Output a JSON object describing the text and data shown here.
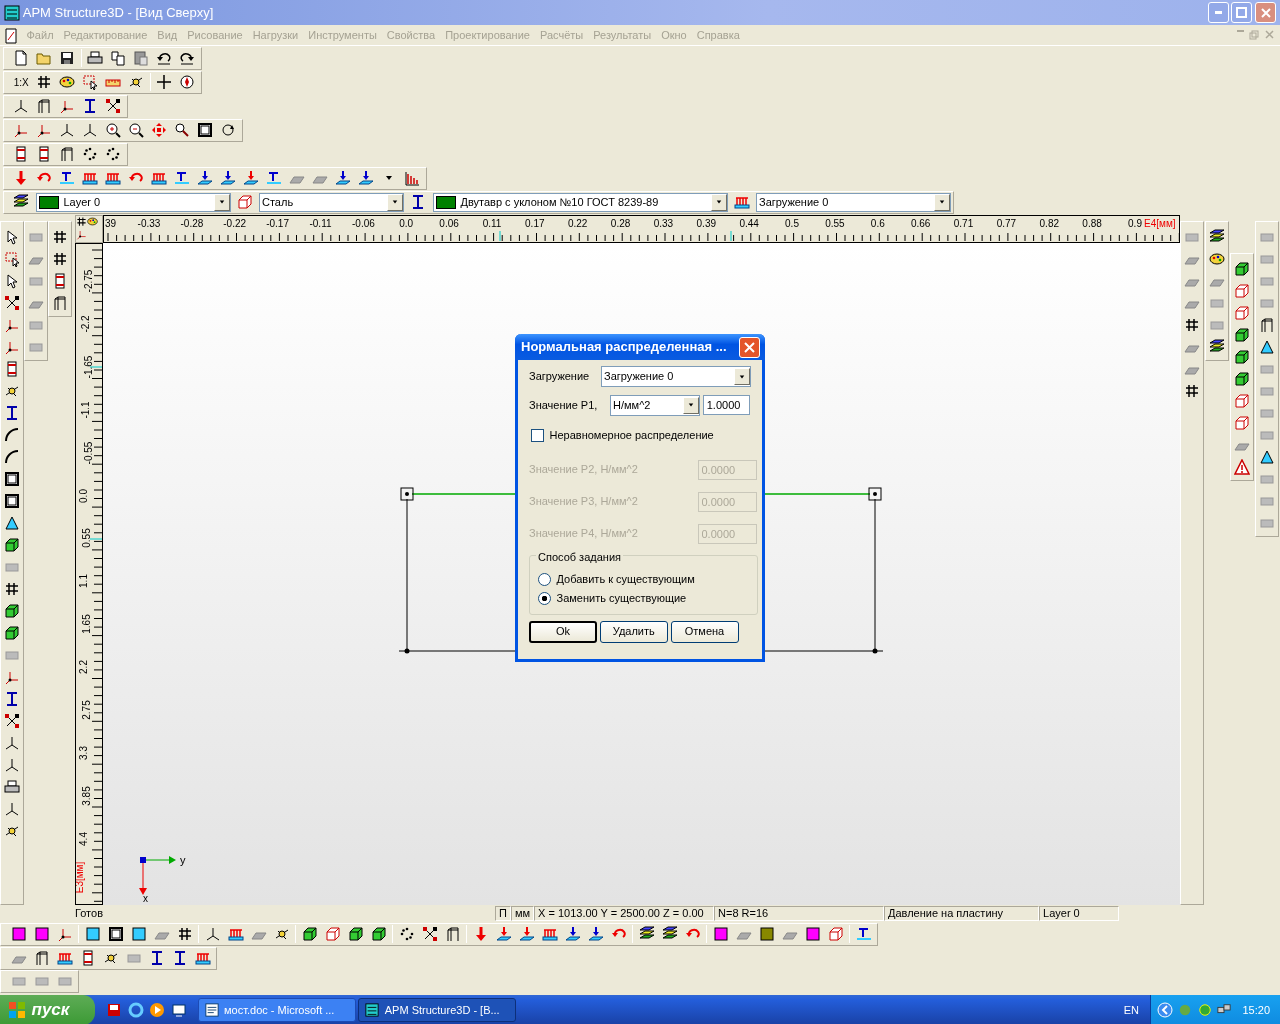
{
  "window": {
    "title": "APM Structure3D - [Вид Сверху]"
  },
  "menu": [
    {
      "label": "Файл",
      "disabled": true
    },
    {
      "label": "Редактирование",
      "disabled": true
    },
    {
      "label": "Вид",
      "disabled": true
    },
    {
      "label": "Рисование",
      "disabled": true
    },
    {
      "label": "Нагрузки",
      "disabled": true
    },
    {
      "label": "Инструменты",
      "disabled": true
    },
    {
      "label": "Свойства",
      "disabled": true
    },
    {
      "label": "Проектирование",
      "disabled": true
    },
    {
      "label": "Расчёты",
      "disabled": true
    },
    {
      "label": "Результаты",
      "disabled": true
    },
    {
      "label": "Окно",
      "disabled": true
    },
    {
      "label": "Справка",
      "disabled": true
    }
  ],
  "scale_button": "1:X",
  "combos": [
    {
      "kind": "layer",
      "value": "Layer 0",
      "color": "#008000"
    },
    {
      "kind": "material",
      "value": "Сталь"
    },
    {
      "kind": "section",
      "value": "Двутавр с уклоном  №10 ГОСТ 8239-89",
      "color": "#008000"
    },
    {
      "kind": "load",
      "value": "Загружение 0"
    }
  ],
  "ruler_x": {
    "labels": [
      "39",
      "-0.33",
      "-0.28",
      "-0.22",
      "-0.17",
      "-0.11",
      "-0.06",
      "0.0",
      "0.06",
      "0.11",
      "0.17",
      "0.22",
      "0.28",
      "0.33",
      "0.39",
      "0.44",
      "0.5",
      "0.55",
      "0.6",
      "0.66",
      "0.71",
      "0.77",
      "0.82",
      "0.88",
      "0.9"
    ],
    "unit": "E4[мм]"
  },
  "ruler_y": {
    "labels": [
      "-2.75",
      "-2.2",
      "-1.65",
      "-1.1",
      "-0.55",
      "0.0",
      "0.55",
      "1.1",
      "1.65",
      "2.2",
      "2.75",
      "3.3",
      "3.85",
      "4.4"
    ],
    "unit": "E3[мм]"
  },
  "axes": {
    "y_label": "y",
    "x_label": "x"
  },
  "dialog": {
    "title": "Нормальная распределенная ...",
    "load_label": "Загружение",
    "load_value": "Загружение 0",
    "p1_label": "Значение P1,",
    "p1_unit": "Н/мм^2",
    "p1_value": "1.0000",
    "uneven": {
      "label": "Неравномерное распределение",
      "checked": false
    },
    "extra_values": [
      {
        "label": "Значение P2,  Н/мм^2",
        "value": "0.0000",
        "disabled": true
      },
      {
        "label": "Значение P3,  Н/мм^2",
        "value": "0.0000",
        "disabled": true
      },
      {
        "label": "Значение P4,  Н/мм^2",
        "value": "0.0000",
        "disabled": true
      }
    ],
    "method": {
      "legend": "Способ задания",
      "options": [
        {
          "label": "Добавить к существующим",
          "selected": false
        },
        {
          "label": "Заменить существующие",
          "selected": true
        }
      ]
    },
    "buttons": [
      {
        "label": "Ok",
        "default": true
      },
      {
        "label": "Удалить",
        "default": false
      },
      {
        "label": "Отмена",
        "default": false
      }
    ]
  },
  "status_bar": {
    "text": "Готов",
    "cells": [
      "П",
      "мм",
      "X = 1013.00 Y = 2500.00 Z = 0.00",
      "N=8 R=16",
      "Давление на пластину",
      "Layer 0"
    ]
  },
  "taskbar": {
    "start": "пуск",
    "tasks": [
      {
        "label": "мост.doc - Microsoft ...",
        "selected": false
      },
      {
        "label": "APM Structure3D - [В...",
        "selected": true
      }
    ],
    "language": "EN",
    "clock": "15:20"
  }
}
